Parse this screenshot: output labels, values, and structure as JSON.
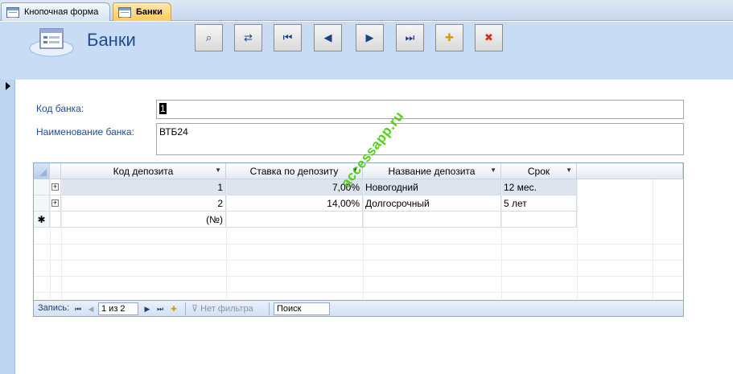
{
  "tabs": [
    {
      "label": "Кнопочная форма",
      "active": false
    },
    {
      "label": "Банки",
      "active": true
    }
  ],
  "header": {
    "title": "Банки",
    "buttons": [
      {
        "name": "find",
        "icon": "binoculars-icon",
        "glyph": "⌕"
      },
      {
        "name": "replace",
        "icon": "replace-icon",
        "glyph": "⇄"
      },
      {
        "name": "first-record",
        "icon": "first-record-icon",
        "glyph": "⏮"
      },
      {
        "name": "previous-record",
        "icon": "previous-record-icon",
        "glyph": "◀"
      },
      {
        "name": "next-record",
        "icon": "next-record-icon",
        "glyph": "▶"
      },
      {
        "name": "last-record",
        "icon": "last-record-icon",
        "glyph": "⏭"
      },
      {
        "name": "new-record",
        "icon": "new-record-icon",
        "glyph": "✚"
      },
      {
        "name": "delete-record",
        "icon": "delete-record-icon",
        "glyph": "✖"
      }
    ]
  },
  "fields": {
    "bank_code": {
      "label": "Код банка:",
      "value": "1"
    },
    "bank_name": {
      "label": "Наименование банка:",
      "value": "ВТБ24"
    }
  },
  "subform": {
    "columns": [
      "Код депозита",
      "Ставка по депозиту",
      "Название депозита",
      "Срок"
    ],
    "rows": [
      {
        "code": "1",
        "rate": "7,00%",
        "name": "Новогодний",
        "term": "12 мес."
      },
      {
        "code": "2",
        "rate": "14,00%",
        "name": "Долгосрочный",
        "term": "5 лет"
      }
    ],
    "new_row": {
      "marker": "✱",
      "code": "(№)"
    },
    "navigation": {
      "record_label": "Запись:",
      "position": "1 из 2",
      "filter_label": "Нет фильтра",
      "search_label": "Поиск"
    }
  },
  "watermark": "accessapp.ru",
  "colors": {
    "header_bg": "#c8dcf5",
    "title": "#1f4d8f",
    "active_tab": "#ffc95c",
    "watermark": "#44cc00"
  }
}
